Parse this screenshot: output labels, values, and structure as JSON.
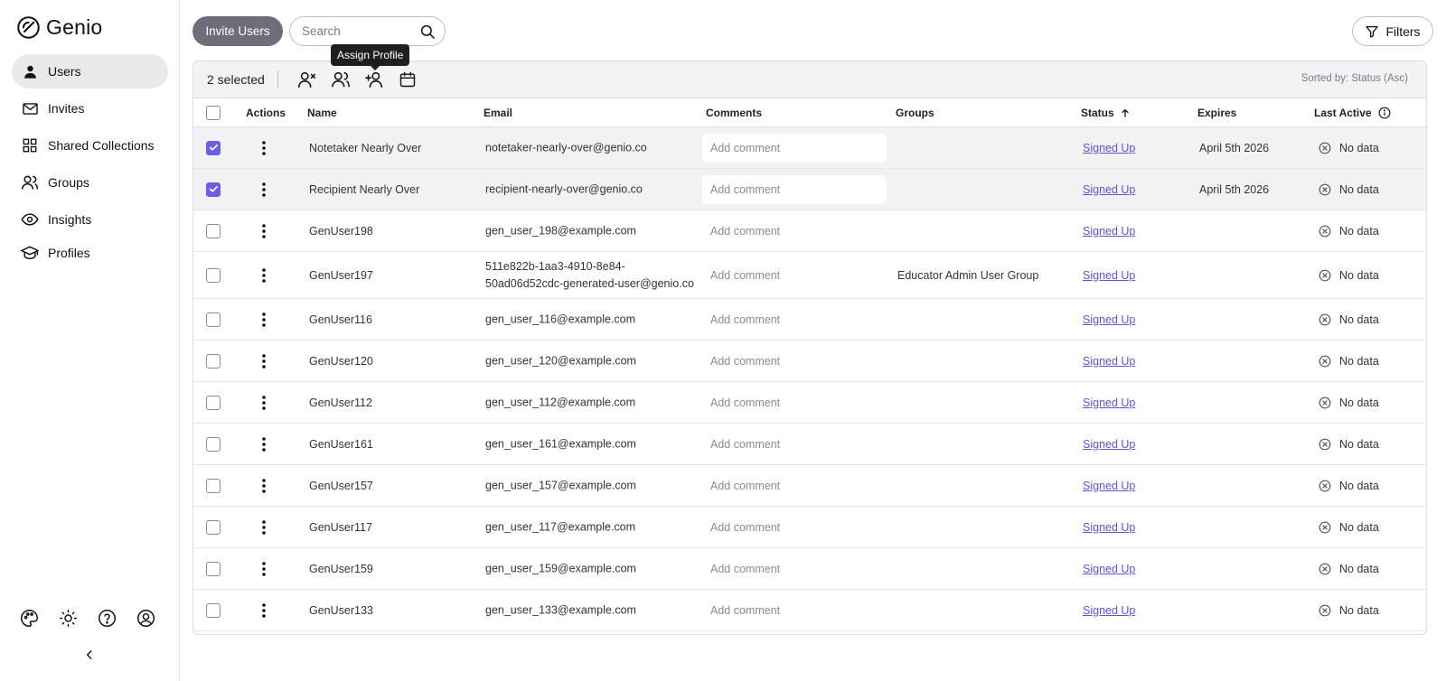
{
  "app": {
    "name": "Genio"
  },
  "sidebar": {
    "items": [
      {
        "label": "Users",
        "icon": "user-icon",
        "active": true
      },
      {
        "label": "Invites",
        "icon": "mail-icon"
      },
      {
        "label": "Shared Collections",
        "icon": "grid-icon"
      },
      {
        "label": "Groups",
        "icon": "users-icon"
      },
      {
        "label": "Insights",
        "icon": "eye-icon"
      },
      {
        "label": "Profiles",
        "icon": "graduation-cap-icon"
      }
    ],
    "bottom_icons": [
      "palette-icon",
      "sun-icon",
      "help-icon",
      "account-icon"
    ],
    "collapse_icon": "chevron-left-icon"
  },
  "toolbar": {
    "invite_label": "Invite Users",
    "search_placeholder": "Search",
    "filters_label": "Filters"
  },
  "selection": {
    "count_label": "2 selected",
    "sorted_label": "Sorted by: Status (Asc)",
    "tooltip": "Assign Profile"
  },
  "table": {
    "headers": {
      "actions": "Actions",
      "name": "Name",
      "email": "Email",
      "comments": "Comments",
      "groups": "Groups",
      "status": "Status",
      "expires": "Expires",
      "last_active": "Last Active"
    },
    "comment_placeholder": "Add comment",
    "rows": [
      {
        "name": "Notetaker Nearly Over",
        "email": "notetaker-nearly-over@genio.co",
        "groups": "",
        "status": "Signed Up",
        "expires": "April 5th 2026",
        "last_active": "No data",
        "selected": true
      },
      {
        "name": "Recipient Nearly Over",
        "email": "recipient-nearly-over@genio.co",
        "groups": "",
        "status": "Signed Up",
        "expires": "April 5th 2026",
        "last_active": "No data",
        "selected": true
      },
      {
        "name": "GenUser198",
        "email": "gen_user_198@example.com",
        "groups": "",
        "status": "Signed Up",
        "expires": "",
        "last_active": "No data"
      },
      {
        "name": "GenUser197",
        "email_line1": "511e822b-1aa3-4910-8e84-",
        "email_line2": "50ad06d52cdc-generated-user@genio.co",
        "groups": "Educator Admin User Group",
        "status": "Signed Up",
        "expires": "",
        "last_active": "No data"
      },
      {
        "name": "GenUser116",
        "email": "gen_user_116@example.com",
        "groups": "",
        "status": "Signed Up",
        "expires": "",
        "last_active": "No data"
      },
      {
        "name": "GenUser120",
        "email": "gen_user_120@example.com",
        "groups": "",
        "status": "Signed Up",
        "expires": "",
        "last_active": "No data"
      },
      {
        "name": "GenUser112",
        "email": "gen_user_112@example.com",
        "groups": "",
        "status": "Signed Up",
        "expires": "",
        "last_active": "No data"
      },
      {
        "name": "GenUser161",
        "email": "gen_user_161@example.com",
        "groups": "",
        "status": "Signed Up",
        "expires": "",
        "last_active": "No data"
      },
      {
        "name": "GenUser157",
        "email": "gen_user_157@example.com",
        "groups": "",
        "status": "Signed Up",
        "expires": "",
        "last_active": "No data"
      },
      {
        "name": "GenUser117",
        "email": "gen_user_117@example.com",
        "groups": "",
        "status": "Signed Up",
        "expires": "",
        "last_active": "No data"
      },
      {
        "name": "GenUser159",
        "email": "gen_user_159@example.com",
        "groups": "",
        "status": "Signed Up",
        "expires": "",
        "last_active": "No data"
      },
      {
        "name": "GenUser133",
        "email": "gen_user_133@example.com",
        "groups": "",
        "status": "Signed Up",
        "expires": "",
        "last_active": "No data"
      }
    ]
  },
  "colors": {
    "accent": "#6b5ee0",
    "link": "#5b55d6",
    "primary_button": "#6e6e7a"
  }
}
